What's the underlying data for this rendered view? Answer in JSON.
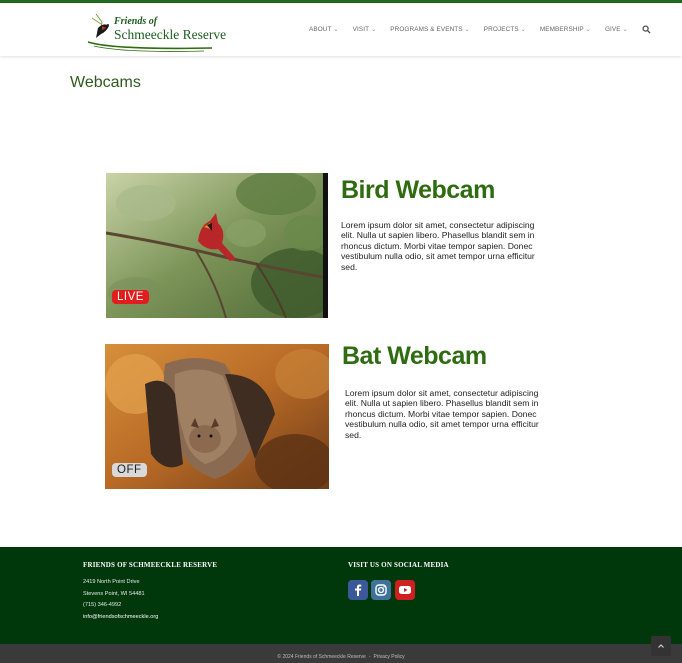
{
  "brand": {
    "name_line1": "Friends of",
    "name_line2": "Schmeeckle Reserve",
    "primary_color": "#1e6b1e",
    "footer_color": "#00380b"
  },
  "nav": {
    "items": [
      {
        "label": "ABOUT"
      },
      {
        "label": "VISIT"
      },
      {
        "label": "PROGRAMS & EVENTS"
      },
      {
        "label": "PROJECTS"
      },
      {
        "label": "MEMBERSHIP"
      },
      {
        "label": "GIVE"
      }
    ],
    "caret": "⌄",
    "search_icon": "search-icon"
  },
  "page": {
    "title": "Webcams"
  },
  "webcams": [
    {
      "title": "Bird Webcam",
      "description": "Lorem ipsum dolor sit amet, consectetur adipiscing elit. Nulla ut sapien libero. Phasellus blandit sem in rhoncus dictum. Morbi vitae tempor sapien. Donec vestibulum nulla odio, sit amet tempor urna efficitur sed.",
      "status": "LIVE",
      "status_color": "#e11d1d"
    },
    {
      "title": "Bat Webcam",
      "description": "Lorem ipsum dolor sit amet, consectetur adipiscing elit. Nulla ut sapien libero. Phasellus blandit sem in rhoncus dictum. Morbi vitae tempor sapien. Donec vestibulum nulla odio, sit amet tempor urna efficitur sed.",
      "status": "OFF",
      "status_color": "#d9d9d9"
    }
  ],
  "footer": {
    "org_heading": "FRIENDS OF SCHMEECKLE RESERVE",
    "address1": "2419 North Point Drive",
    "address2": "Stevens Point, WI 54481",
    "phone": "(715) 346-4992",
    "email": "info@friendsofschmeeckle.org",
    "social_heading": "VISIT US ON SOCIAL MEDIA",
    "social": [
      {
        "icon": "facebook-icon",
        "color": "#3b5998"
      },
      {
        "icon": "instagram-icon",
        "color": "#3f729b"
      },
      {
        "icon": "youtube-icon",
        "color": "#cd201f"
      }
    ]
  },
  "bottom_bar": {
    "copyright": "© 2024 Friends of Schmeeckle Reserve",
    "separator": "-",
    "privacy_label": "Privacy Policy"
  }
}
